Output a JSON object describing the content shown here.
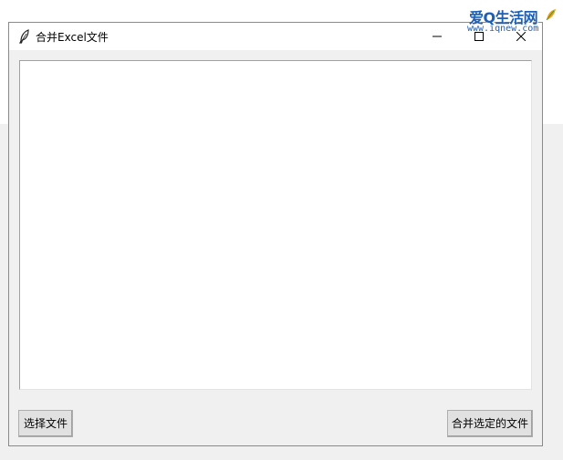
{
  "window": {
    "title": "合并Excel文件",
    "app_icon": "feather-icon",
    "controls": [
      "minimize-icon",
      "maximize-icon",
      "close-icon"
    ]
  },
  "file_list": {
    "items": []
  },
  "buttons": {
    "select_files": "选择文件",
    "merge_selected": "合并选定的文件"
  },
  "watermark": {
    "brand": "爱Q生活网",
    "url": "www.iqnew.com"
  }
}
